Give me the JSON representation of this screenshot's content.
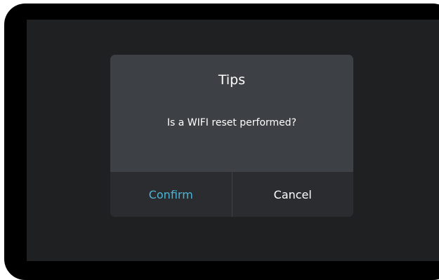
{
  "dialog": {
    "title": "Tips",
    "message": "Is a WIFI reset performed?",
    "confirm_label": "Confirm",
    "cancel_label": "Cancel"
  },
  "colors": {
    "screen_background": "#1e2022",
    "dialog_background": "#3d4044",
    "button_bar_background": "#2a2c2f",
    "confirm_accent": "#4fb3d4",
    "text": "#ffffff"
  }
}
